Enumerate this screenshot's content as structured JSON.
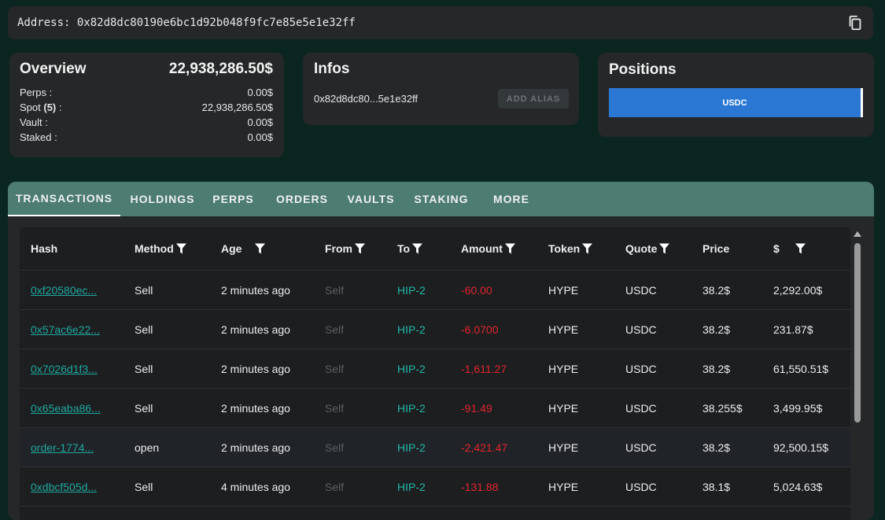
{
  "address": {
    "label": "Address: 0x82d8dc80190e6bc1d92b048f9fc7e85e5e1e32ff"
  },
  "overview": {
    "title": "Overview",
    "total": "22,938,286.50$",
    "rows": [
      {
        "label": "Perps :",
        "count": "",
        "suffix": "",
        "value": "0.00$"
      },
      {
        "label": "Spot ",
        "count": "(5)",
        "suffix": " :",
        "value": "22,938,286.50$"
      },
      {
        "label": "Vault :",
        "count": "",
        "suffix": "",
        "value": "0.00$"
      },
      {
        "label": "Staked :",
        "count": "",
        "suffix": "",
        "value": "0.00$"
      }
    ]
  },
  "infos": {
    "title": "Infos",
    "short_address": "0x82d8dc80...5e1e32ff",
    "add_alias_label": "ADD ALIAS"
  },
  "positions": {
    "title": "Positions",
    "items": [
      {
        "token": "USDC",
        "share_percent": 100
      }
    ],
    "bar_color": "#2b78d4"
  },
  "tabs": [
    "TRANSACTIONS",
    "HOLDINGS",
    "PERPS",
    "ORDERS",
    "VAULTS",
    "STAKING",
    "MORE"
  ],
  "active_tab": "TRANSACTIONS",
  "table": {
    "columns": [
      {
        "label": "Hash",
        "filter": false
      },
      {
        "label": "Method",
        "filter": true
      },
      {
        "label": "Age",
        "filter": true
      },
      {
        "label": "From",
        "filter": true
      },
      {
        "label": "To",
        "filter": true
      },
      {
        "label": "Amount",
        "filter": true
      },
      {
        "label": "Token",
        "filter": true
      },
      {
        "label": "Quote",
        "filter": true
      },
      {
        "label": "Price",
        "filter": false
      },
      {
        "label": "$",
        "filter": true
      }
    ],
    "rows": [
      {
        "hash": "0xf20580ec...",
        "method": "Sell",
        "age": "2 minutes ago",
        "from": "Self",
        "to": "HIP-2",
        "amount": "-60.00",
        "token": "HYPE",
        "quote": "USDC",
        "price": "38.2$",
        "usd": "2,292.00$"
      },
      {
        "hash": "0x57ac6e22...",
        "method": "Sell",
        "age": "2 minutes ago",
        "from": "Self",
        "to": "HIP-2",
        "amount": "-6.0700",
        "token": "HYPE",
        "quote": "USDC",
        "price": "38.2$",
        "usd": "231.87$"
      },
      {
        "hash": "0x7026d1f3...",
        "method": "Sell",
        "age": "2 minutes ago",
        "from": "Self",
        "to": "HIP-2",
        "amount": "-1,611.27",
        "token": "HYPE",
        "quote": "USDC",
        "price": "38.2$",
        "usd": "61,550.51$"
      },
      {
        "hash": "0x65eaba86...",
        "method": "Sell",
        "age": "2 minutes ago",
        "from": "Self",
        "to": "HIP-2",
        "amount": "-91.49",
        "token": "HYPE",
        "quote": "USDC",
        "price": "38.255$",
        "usd": "3,499.95$"
      },
      {
        "hash": "order-1774...",
        "method": "open",
        "age": "2 minutes ago",
        "from": "Self",
        "to": "HIP-2",
        "amount": "-2,421.47",
        "token": "HYPE",
        "quote": "USDC",
        "price": "38.2$",
        "usd": "92,500.15$"
      },
      {
        "hash": "0xdbcf505d...",
        "method": "Sell",
        "age": "4 minutes ago",
        "from": "Self",
        "to": "HIP-2",
        "amount": "-131.88",
        "token": "HYPE",
        "quote": "USDC",
        "price": "38.1$",
        "usd": "5,024.63$"
      }
    ]
  },
  "colors": {
    "background": "#0b2620",
    "card": "#252729",
    "tab_bar": "#4c7c72",
    "hash_link": "#1fa8a0",
    "to_teal": "#22b8a8",
    "amount_negative": "#e5252d",
    "self_muted": "#5c6064"
  }
}
